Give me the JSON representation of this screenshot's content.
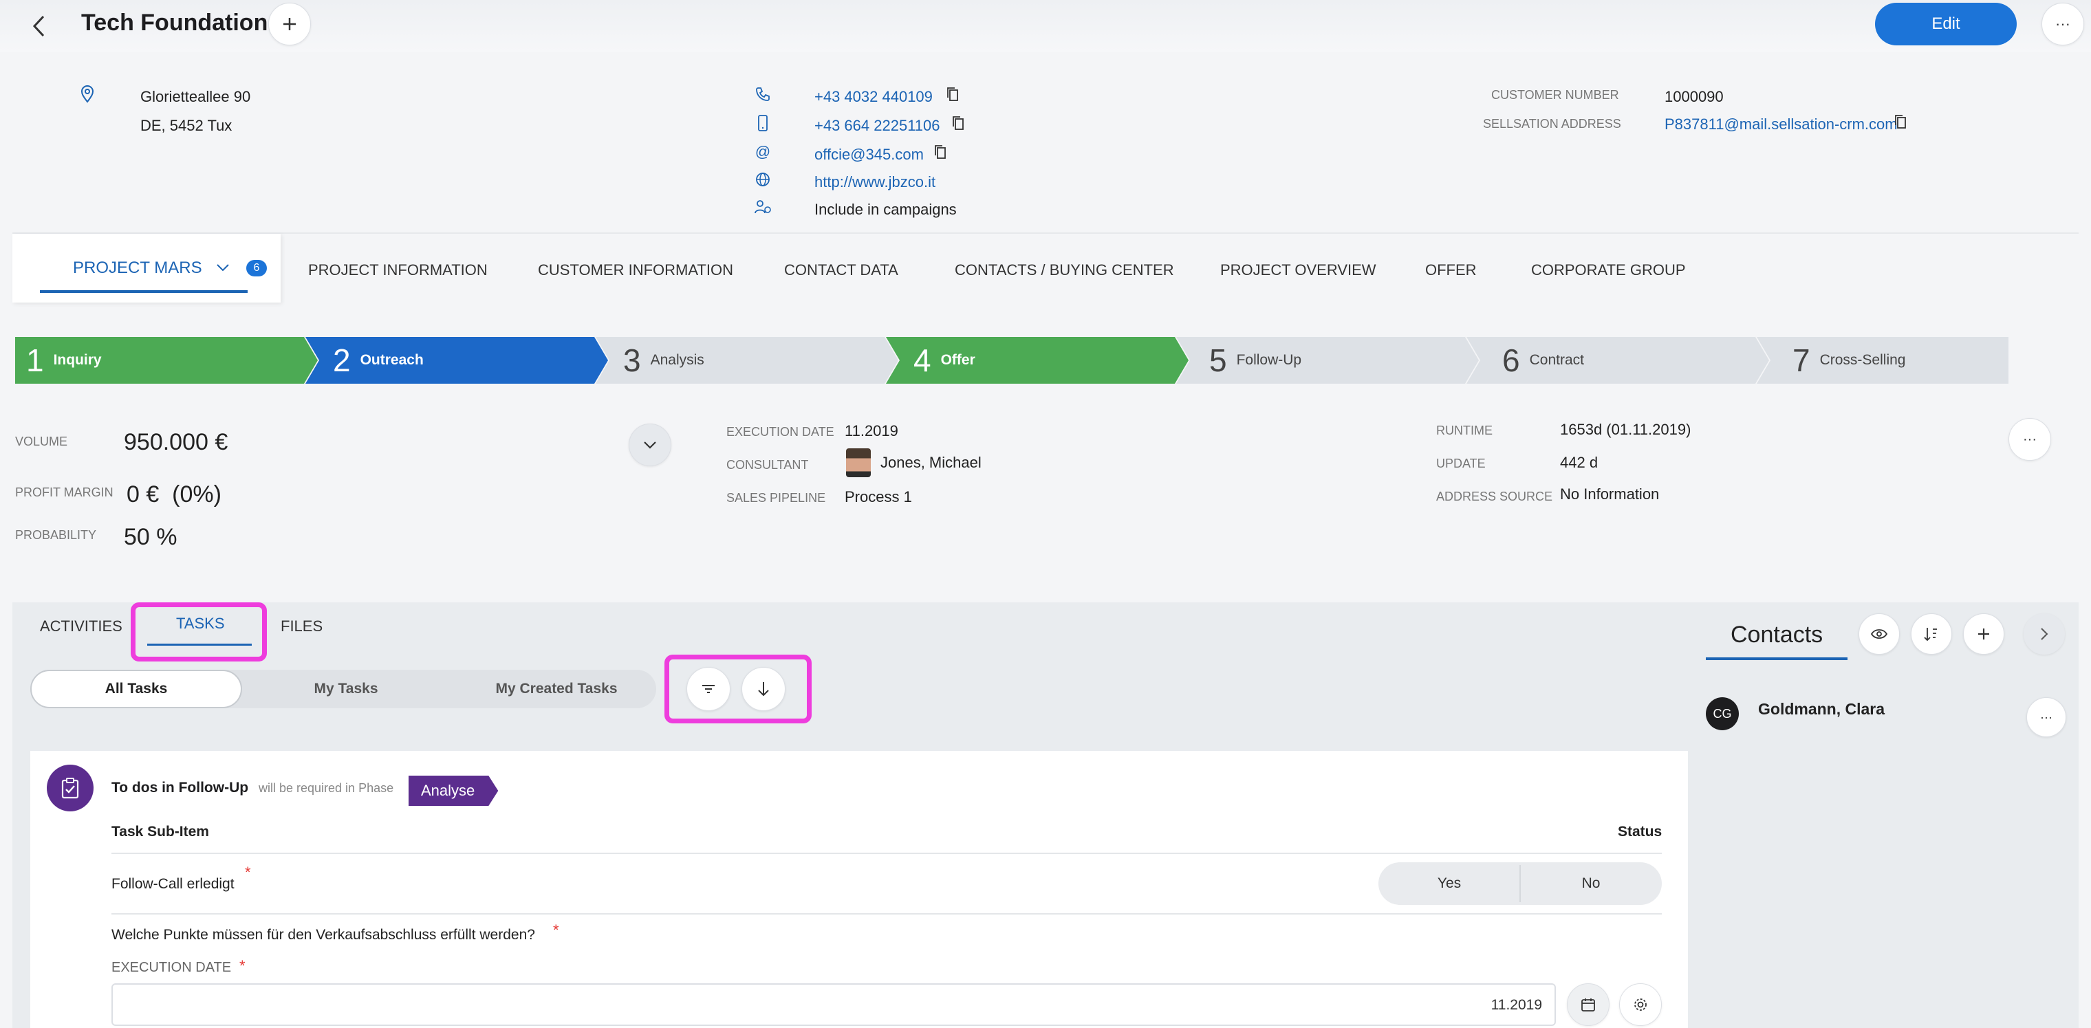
{
  "header": {
    "title": "Tech Foundation",
    "edit_label": "Edit"
  },
  "address": {
    "line1": "Glorietteallee 90",
    "line2": "DE, 5452 Tux"
  },
  "contact_info": {
    "phone": "+43 4032 440109",
    "mobile": "+43 664 22251106",
    "email": "offcie@345.com",
    "website": "http://www.jbzco.it",
    "campaigns": "Include in campaigns"
  },
  "customer": {
    "number_label": "CUSTOMER NUMBER",
    "number": "1000090",
    "address_label": "SELLSATION ADDRESS",
    "address": "P837811@mail.sellsation-crm.com"
  },
  "nav": {
    "project_label": "PROJECT MARS",
    "project_badge": "6",
    "items": [
      "PROJECT INFORMATION",
      "CUSTOMER INFORMATION",
      "CONTACT DATA",
      "CONTACTS / BUYING CENTER",
      "PROJECT OVERVIEW",
      "OFFER",
      "CORPORATE GROUP"
    ]
  },
  "pipeline": [
    {
      "num": "1",
      "label": "Inquiry",
      "color": "#4caa54"
    },
    {
      "num": "2",
      "label": "Outreach",
      "color": "#1c68c8"
    },
    {
      "num": "3",
      "label": "Analysis",
      "color": "#dde1e6"
    },
    {
      "num": "4",
      "label": "Offer",
      "color": "#4caa54"
    },
    {
      "num": "5",
      "label": "Follow-Up",
      "color": "#dde1e6"
    },
    {
      "num": "6",
      "label": "Contract",
      "color": "#dde1e6"
    },
    {
      "num": "7",
      "label": "Cross-Selling",
      "color": "#dde1e6"
    }
  ],
  "summary": {
    "volume_label": "VOLUME",
    "volume": "950.000 €",
    "profit_label": "PROFIT MARGIN",
    "profit": "0 €  (0%)",
    "probability_label": "PROBABILITY",
    "probability": "50 %",
    "exec_label": "EXECUTION DATE",
    "exec": "11.2019",
    "consultant_label": "CONSULTANT",
    "consultant": "Jones, Michael",
    "pipeline_label": "SALES PIPELINE",
    "pipeline": "Process 1",
    "runtime_label": "RUNTIME",
    "runtime": "1653d (01.11.2019)",
    "update_label": "UPDATE",
    "update": "442 d",
    "source_label": "ADDRESS SOURCE",
    "source": "No Information"
  },
  "tabs": {
    "activities": "ACTIVITIES",
    "tasks": "TASKS",
    "files": "FILES"
  },
  "filter": {
    "all": "All Tasks",
    "mine": "My Tasks",
    "created": "My Created Tasks"
  },
  "task": {
    "title": "To dos in Follow-Up",
    "required_text": "will be required in Phase",
    "phase": "Analyse",
    "col_item": "Task Sub-Item",
    "col_status": "Status",
    "item1": "Follow-Call erledigt",
    "yes": "Yes",
    "no": "No",
    "question": "Welche Punkte müssen für den Verkaufsabschluss erfüllt werden?",
    "exec_label": "EXECUTION DATE",
    "exec_value": "11.2019",
    "required_mark": "*"
  },
  "contacts": {
    "title": "Contacts",
    "items": [
      {
        "initials": "CG",
        "name": "Goldmann, Clara"
      }
    ]
  },
  "colors": {
    "accent": "#1c74d8",
    "highlight": "#ee3ddd",
    "phase_badge": "#5b2d8e"
  }
}
